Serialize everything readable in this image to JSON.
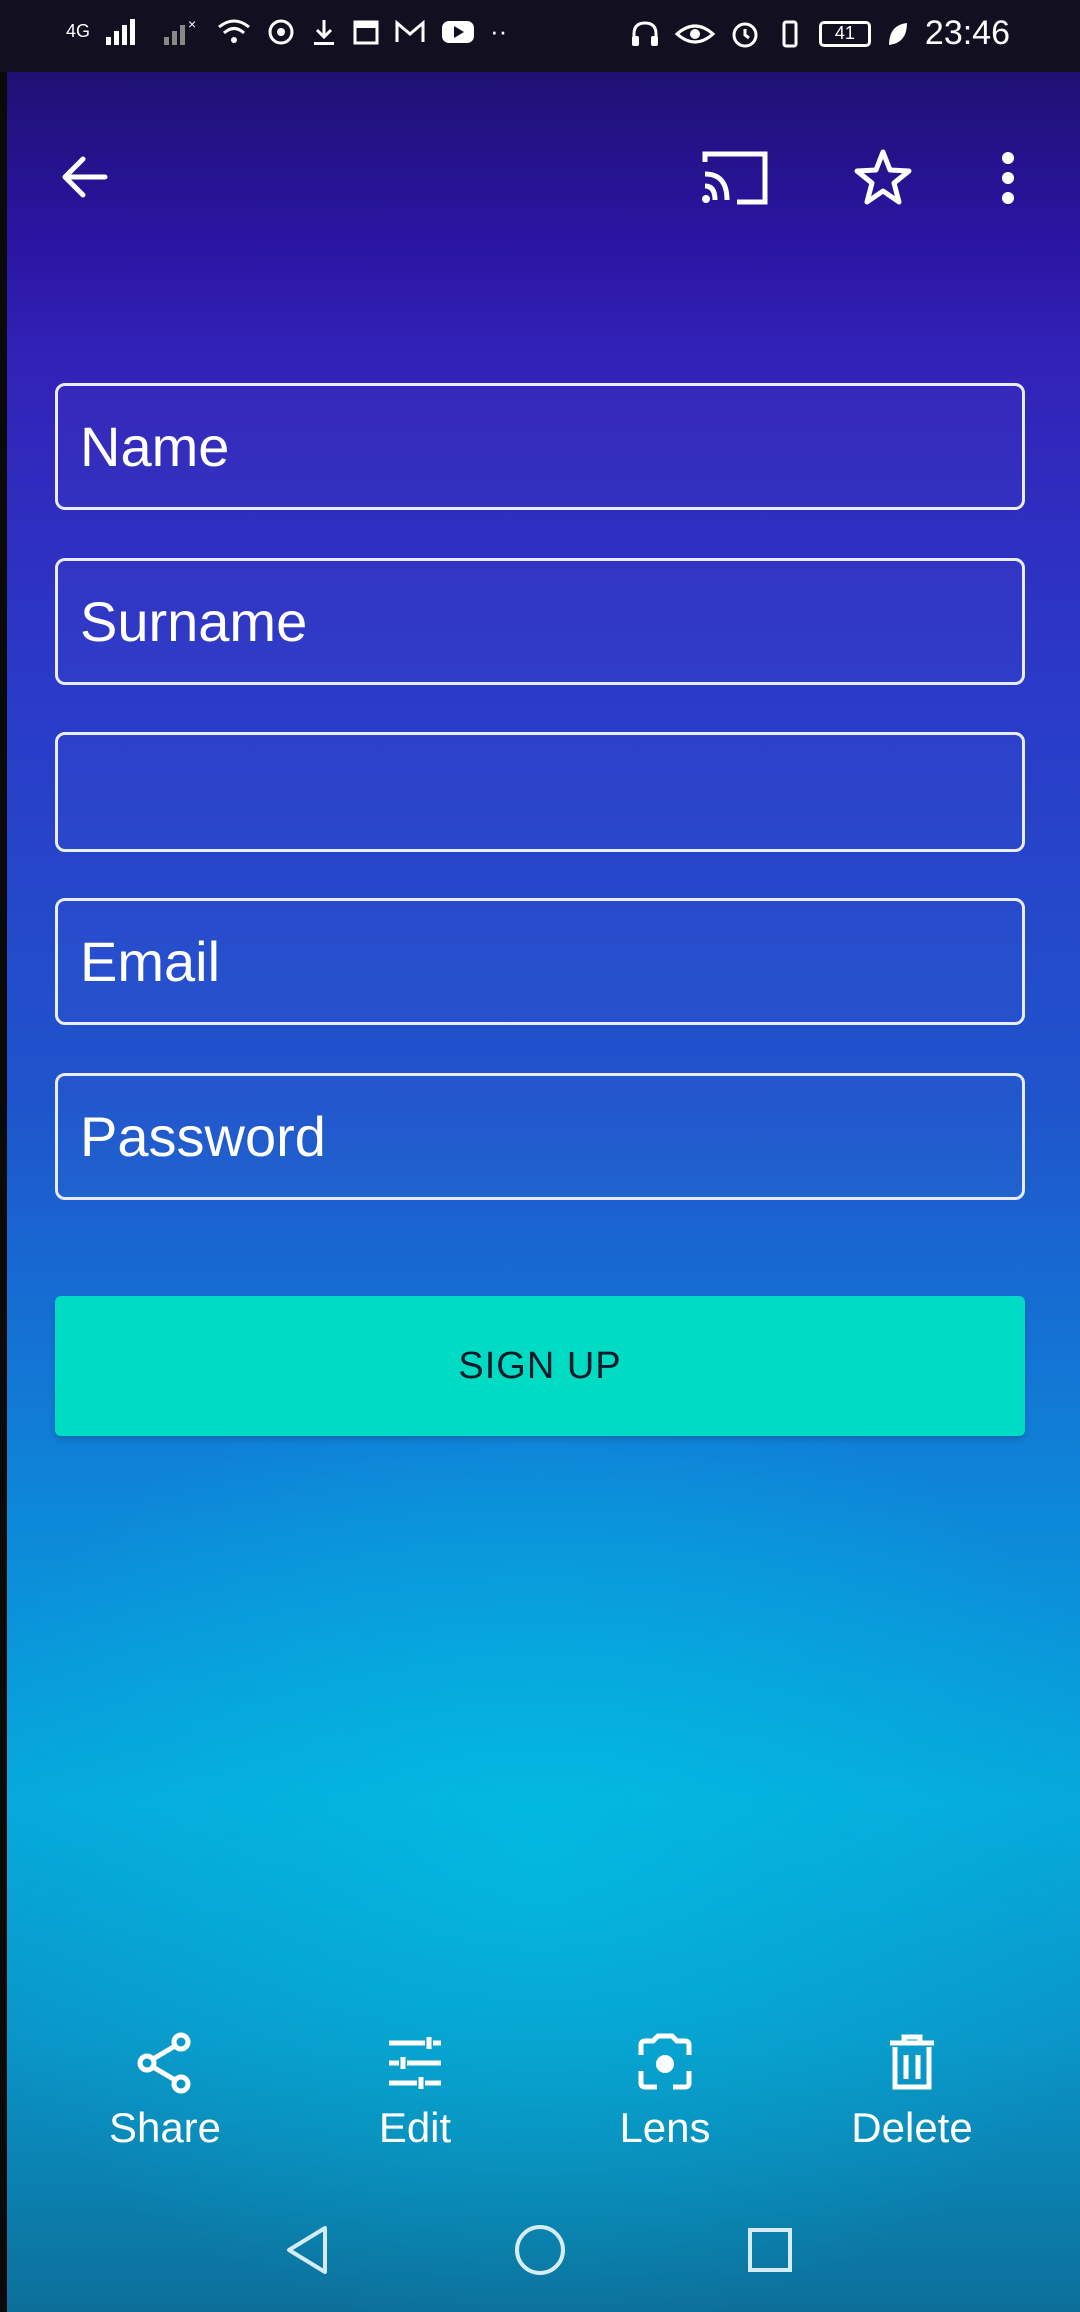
{
  "status_bar": {
    "network_label": "4G",
    "time": "23:46",
    "battery": "41"
  },
  "top_bar": {
    "back_icon": "arrow-back-icon",
    "cast_icon": "cast-icon",
    "star_icon": "star-outline-icon",
    "more_icon": "more-vert-icon"
  },
  "form": {
    "name_placeholder": "Name",
    "surname_placeholder": "Surname",
    "blank_value": "",
    "email_placeholder": "Email",
    "password_placeholder": "Password",
    "signup_label": "SIGN UP",
    "button_color": "#00dcc4"
  },
  "actions": {
    "share_label": "Share",
    "edit_label": "Edit",
    "lens_label": "Lens",
    "delete_label": "Delete"
  },
  "nav": {
    "back_icon": "triangle-back-icon",
    "home_icon": "circle-home-icon",
    "recent_icon": "square-recents-icon"
  }
}
